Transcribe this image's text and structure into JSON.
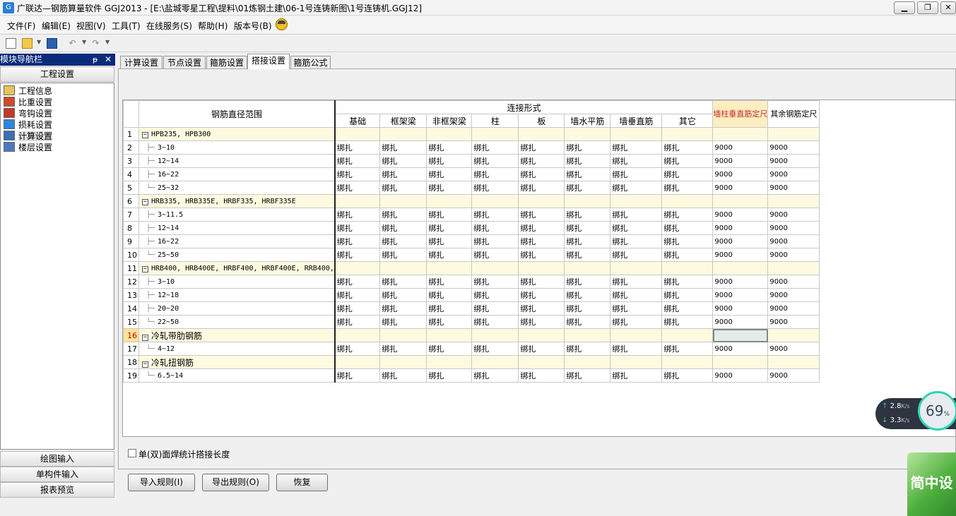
{
  "window": {
    "title": "广联达—钢筋算量软件 GGJ2013 - [E:\\盐城零星工程\\提料\\01炼钢土建\\06-1号连铸新图\\1号连铸机.GGJ12]",
    "minimize_label": "▁",
    "restore_label": "❐",
    "close_label": "✕"
  },
  "menu": {
    "file": "文件(F)",
    "edit": "编辑(E)",
    "view": "视图(V)",
    "tools": "工具(T)",
    "online": "在线服务(S)",
    "help": "帮助(H)",
    "version": "版本号(B)"
  },
  "nav": {
    "title": "模块导航栏",
    "pin_icon": "ᵽ",
    "close_icon": "✕",
    "project_settings": "工程设置",
    "items": [
      {
        "label": "工程信息",
        "icon": "project-info-icon",
        "color": "#e8c35a"
      },
      {
        "label": "比重设置",
        "icon": "weight-icon",
        "color": "#d04a2a"
      },
      {
        "label": "弯钩设置",
        "icon": "hook-icon",
        "color": "#c0392b"
      },
      {
        "label": "损耗设置",
        "icon": "loss-icon",
        "color": "#2e86de"
      },
      {
        "label": "计算设置",
        "icon": "calc-settings-icon",
        "color": "#3b6fb6"
      },
      {
        "label": "楼层设置",
        "icon": "floor-icon",
        "color": "#4a78c2"
      }
    ],
    "bottom": [
      "绘图输入",
      "单构件输入",
      "报表预览"
    ]
  },
  "tabs": [
    "计算设置",
    "节点设置",
    "箍筋设置",
    "搭接设置",
    "箍筋公式"
  ],
  "active_tab": 3,
  "table": {
    "header_range": "钢筋直径范围",
    "header_connection": "连接形式",
    "conn_columns": [
      "基础",
      "框架梁",
      "非框架梁",
      "柱",
      "板",
      "墙水平筋",
      "墙垂直筋",
      "其它"
    ],
    "header_wall_col": "墙柱垂直筋定尺",
    "header_other": "其余钢筋定尺",
    "conn_value": "绑扎",
    "rows": [
      {
        "n": "1",
        "type": "group",
        "label": "HPB235, HPB300",
        "cn": false
      },
      {
        "n": "2",
        "type": "item",
        "label": "3~10",
        "a": "9000",
        "b": "9000",
        "tail": false
      },
      {
        "n": "3",
        "type": "item",
        "label": "12~14",
        "a": "9000",
        "b": "9000",
        "tail": false
      },
      {
        "n": "4",
        "type": "item",
        "label": "16~22",
        "a": "9000",
        "b": "9000",
        "tail": false
      },
      {
        "n": "5",
        "type": "item",
        "label": "25~32",
        "a": "9000",
        "b": "9000",
        "tail": true
      },
      {
        "n": "6",
        "type": "group",
        "label": "HRB335, HRB335E, HRBF335, HRBF335E",
        "cn": false
      },
      {
        "n": "7",
        "type": "item",
        "label": "3~11.5",
        "a": "9000",
        "b": "9000",
        "tail": false
      },
      {
        "n": "8",
        "type": "item",
        "label": "12~14",
        "a": "9000",
        "b": "9000",
        "tail": false
      },
      {
        "n": "9",
        "type": "item",
        "label": "16~22",
        "a": "9000",
        "b": "9000",
        "tail": false
      },
      {
        "n": "10",
        "type": "item",
        "label": "25~50",
        "a": "9000",
        "b": "9000",
        "tail": true
      },
      {
        "n": "11",
        "type": "group",
        "label": "HRB400, HRB400E, HRBF400, HRBF400E, RRB400,",
        "cn": false
      },
      {
        "n": "12",
        "type": "item",
        "label": "3~10",
        "a": "9000",
        "b": "9000",
        "tail": false
      },
      {
        "n": "13",
        "type": "item",
        "label": "12~18",
        "a": "9000",
        "b": "9000",
        "tail": false
      },
      {
        "n": "14",
        "type": "item",
        "label": "20~20",
        "a": "9000",
        "b": "9000",
        "tail": false
      },
      {
        "n": "15",
        "type": "item",
        "label": "22~50",
        "a": "9000",
        "b": "9000",
        "tail": true
      },
      {
        "n": "16",
        "type": "group",
        "label": "冷轧带肋钢筋",
        "cn": true,
        "current": true,
        "selected_cell": true
      },
      {
        "n": "17",
        "type": "item",
        "label": "4~12",
        "a": "9000",
        "b": "9000",
        "tail": true
      },
      {
        "n": "18",
        "type": "group",
        "label": "冷轧扭钢筋",
        "cn": true
      },
      {
        "n": "19",
        "type": "item",
        "label": "6.5~14",
        "a": "9000",
        "b": "9000",
        "tail": true
      }
    ]
  },
  "weld_checkbox_label": "单(双)面焊统计搭接长度",
  "buttons": {
    "import": "导入规则(I)",
    "export": "导出规则(O)",
    "restore": "恢复"
  },
  "net_widget": {
    "up": "2.8",
    "down": "3.3",
    "unit": "K/s",
    "percent": "69",
    "percent_sign": "%"
  },
  "badge_text": "简中设"
}
